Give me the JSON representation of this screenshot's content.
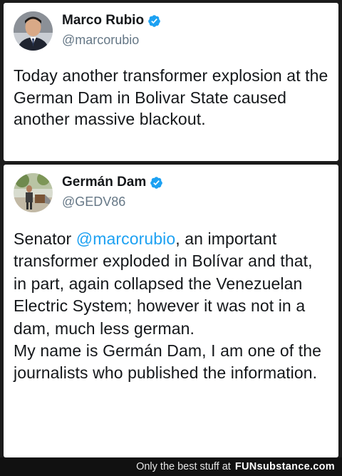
{
  "tweets": [
    {
      "name": "Marco Rubio",
      "handle": "@marcorubio",
      "verified": true,
      "text": "Today another transformer explosion at the German Dam in Bolivar State caused another massive blackout.",
      "avatar_icon": "man-portrait-avatar"
    },
    {
      "name": "Germán Dam",
      "handle": "@GEDV86",
      "verified": true,
      "text_prefix": "Senator ",
      "mention": "@marcorubio",
      "text_suffix": ", an important transformer exploded in Bolívar and that, in part, again collapsed the Venezuelan Electric System; however it was not in a dam, much less german.",
      "text_line2": "My name is Germán Dam, I am one of the journalists who published the information.",
      "avatar_icon": "outdoor-photo-avatar"
    }
  ],
  "footer": {
    "lead": "Only the best stuff at",
    "brand_fun": "FUN",
    "brand_sub": "substance.com"
  },
  "colors": {
    "verified_blue": "#1da1f2",
    "handle_gray": "#657786",
    "mention_blue": "#1da1f2"
  }
}
